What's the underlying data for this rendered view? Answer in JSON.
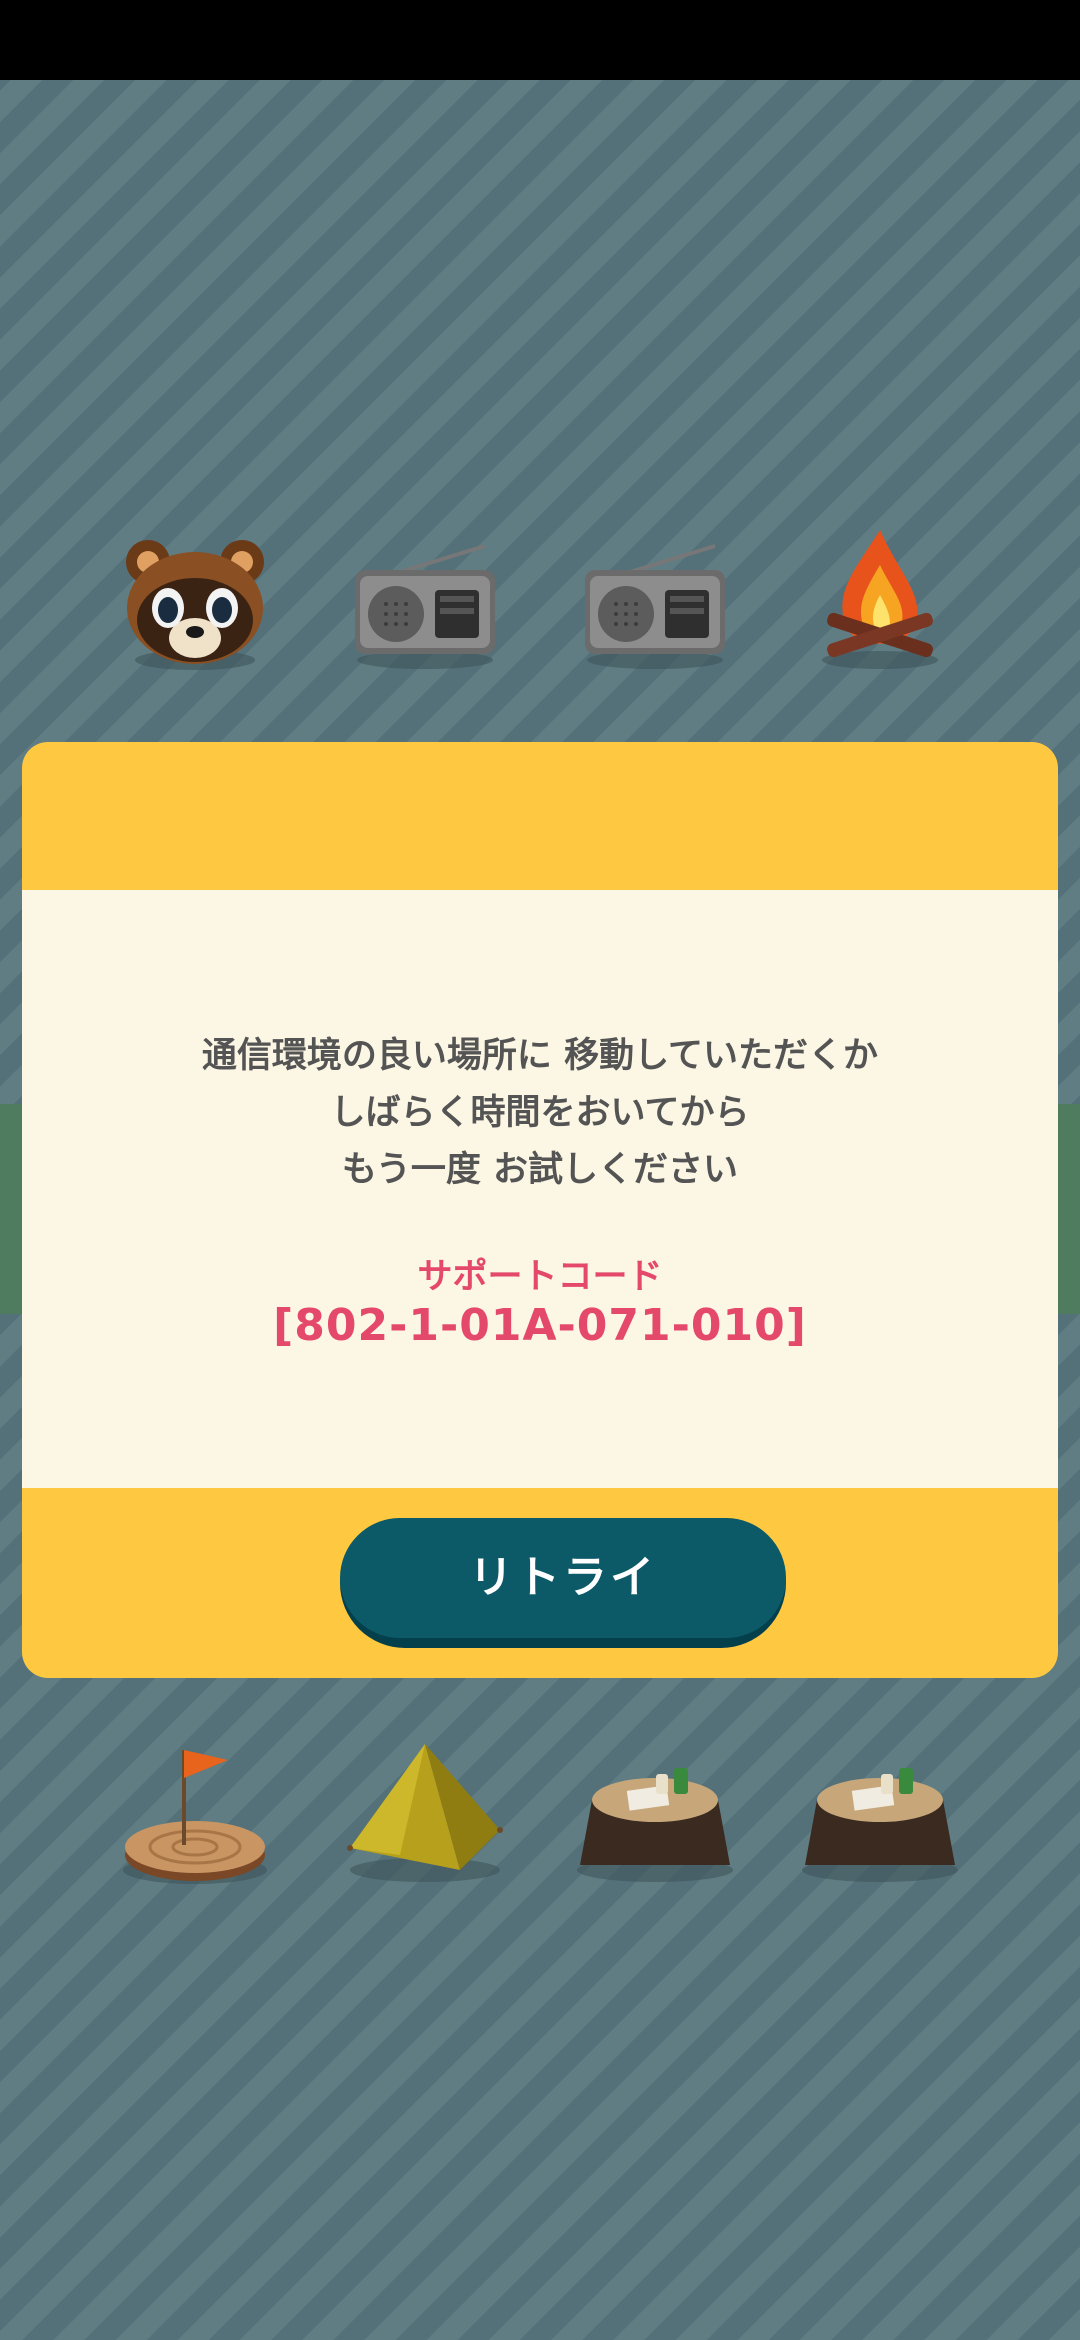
{
  "dialog": {
    "message_lines": [
      "通信環境の良い場所に 移動していただくか",
      "しばらく時間をおいてから",
      "もう一度 お試しください"
    ],
    "support_label": "サポートコード",
    "support_code": "[802-1-01A-071-010]",
    "retry_label": "リトライ"
  },
  "items_top": [
    "tom-nook-icon",
    "radio-icon",
    "radio-icon",
    "campfire-icon"
  ],
  "items_bottom": [
    "flag-stump-icon",
    "tent-icon",
    "stump-table-icon",
    "stump-table-icon"
  ],
  "colors": {
    "dialog_header": "#fec841",
    "dialog_body": "#fcf7e4",
    "support_text": "#e4486b",
    "button": "#0c5a68"
  }
}
